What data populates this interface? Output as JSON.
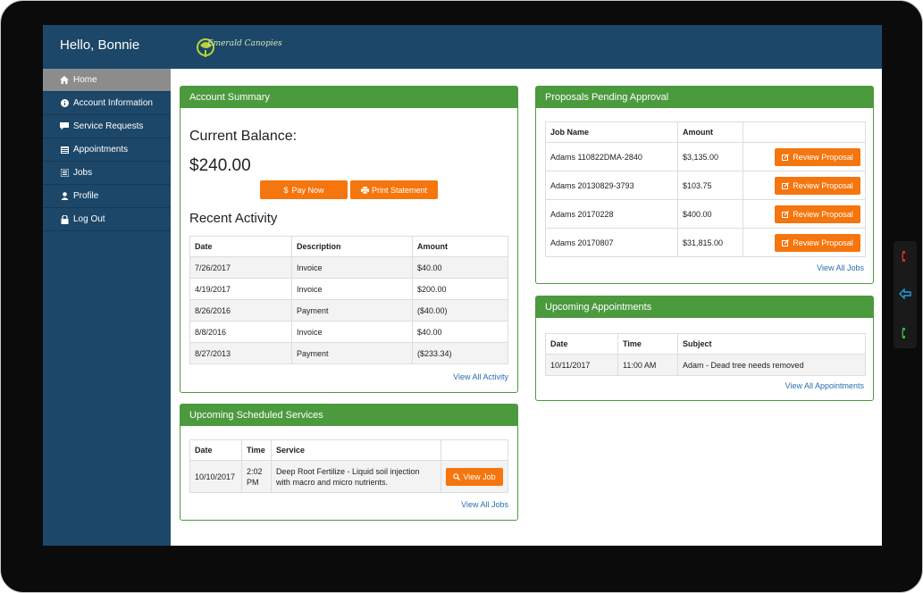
{
  "header": {
    "greeting": "Hello, Bonnie",
    "logo_text": "Emerald Canopies"
  },
  "sidebar": {
    "items": [
      {
        "label": "Home",
        "icon": "home-icon"
      },
      {
        "label": "Account Information",
        "icon": "info-icon"
      },
      {
        "label": "Service Requests",
        "icon": "comment-icon"
      },
      {
        "label": "Appointments",
        "icon": "calendar-icon"
      },
      {
        "label": "Jobs",
        "icon": "list-icon"
      },
      {
        "label": "Profile",
        "icon": "user-icon"
      },
      {
        "label": "Log Out",
        "icon": "lock-icon"
      }
    ]
  },
  "account_summary": {
    "title": "Account Summary",
    "balance_label": "Current Balance:",
    "balance_value": "$240.00",
    "pay_now": "Pay Now",
    "print_statement": "Print Statement",
    "recent_activity_label": "Recent Activity",
    "columns": [
      "Date",
      "Description",
      "Amount"
    ],
    "rows": [
      [
        "7/26/2017",
        "Invoice",
        "$40.00"
      ],
      [
        "4/19/2017",
        "Invoice",
        "$200.00"
      ],
      [
        "8/26/2016",
        "Payment",
        "($40.00)"
      ],
      [
        "8/8/2016",
        "Invoice",
        "$40.00"
      ],
      [
        "8/27/2013",
        "Payment",
        "($233.34)"
      ]
    ],
    "view_all": "View All Activity"
  },
  "scheduled_services": {
    "title": "Upcoming Scheduled Services",
    "columns": [
      "Date",
      "Time",
      "Service"
    ],
    "rows": [
      {
        "date": "10/10/2017",
        "time_1": "2:02",
        "time_2": "PM",
        "service_1": "Deep Root Fertilize - Liquid soil injection",
        "service_2": "with macro and micro nutrients.",
        "button": "View Job"
      }
    ],
    "view_all": "View All Jobs"
  },
  "proposals": {
    "title": "Proposals Pending Approval",
    "columns": [
      "Job Name",
      "Amount"
    ],
    "rows": [
      {
        "job": "Adams 110822DMA-2840",
        "amount": "$3,135.00",
        "button": "Review Proposal"
      },
      {
        "job": "Adams 20130829-3793",
        "amount": "$103.75",
        "button": "Review Proposal"
      },
      {
        "job": "Adams 20170228",
        "amount": "$400.00",
        "button": "Review Proposal"
      },
      {
        "job": "Adams 20170807",
        "amount": "$31,815.00",
        "button": "Review Proposal"
      }
    ],
    "view_all": "View All Jobs"
  },
  "appointments": {
    "title": "Upcoming Appointments",
    "columns": [
      "Date",
      "Time",
      "Subject"
    ],
    "rows": [
      {
        "date": "10/11/2017",
        "time": "11:00 AM",
        "subject": "Adam - Dead tree needs removed"
      }
    ],
    "view_all": "View All Appointments"
  },
  "colors": {
    "navy": "#1d4768",
    "green": "#4c9a3e",
    "orange": "#f5750e",
    "link": "#2a6fb0"
  }
}
